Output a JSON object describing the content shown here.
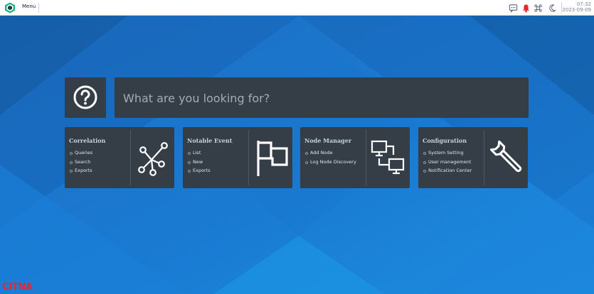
{
  "header": {
    "menu_label": "Menu",
    "time": "07:32",
    "date": "2023-09-09",
    "icons": [
      "chat-icon",
      "bell-icon",
      "command-icon",
      "moon-icon"
    ],
    "bell_color": "#e3282f"
  },
  "search": {
    "placeholder": "What are you looking for?",
    "help_icon": "question-icon"
  },
  "cards": [
    {
      "title": "Correlation",
      "items": [
        "Queries",
        "Search",
        "Exports"
      ],
      "icon": "network-icon"
    },
    {
      "title": "Notable Event",
      "items": [
        "List",
        "New",
        "Exports"
      ],
      "icon": "flag-icon"
    },
    {
      "title": "Node Manager",
      "items": [
        "Add Node",
        "Log Node Discovery"
      ],
      "icon": "connected-monitors-icon"
    },
    {
      "title": "Configuration",
      "items": [
        "System Setting",
        "User management",
        "Notification Center"
      ],
      "icon": "wrench-icon"
    }
  ],
  "watermark": "CITNA",
  "colors": {
    "background": "#1a78d0",
    "panel": "#353e47",
    "accent_red": "#e3282f"
  }
}
